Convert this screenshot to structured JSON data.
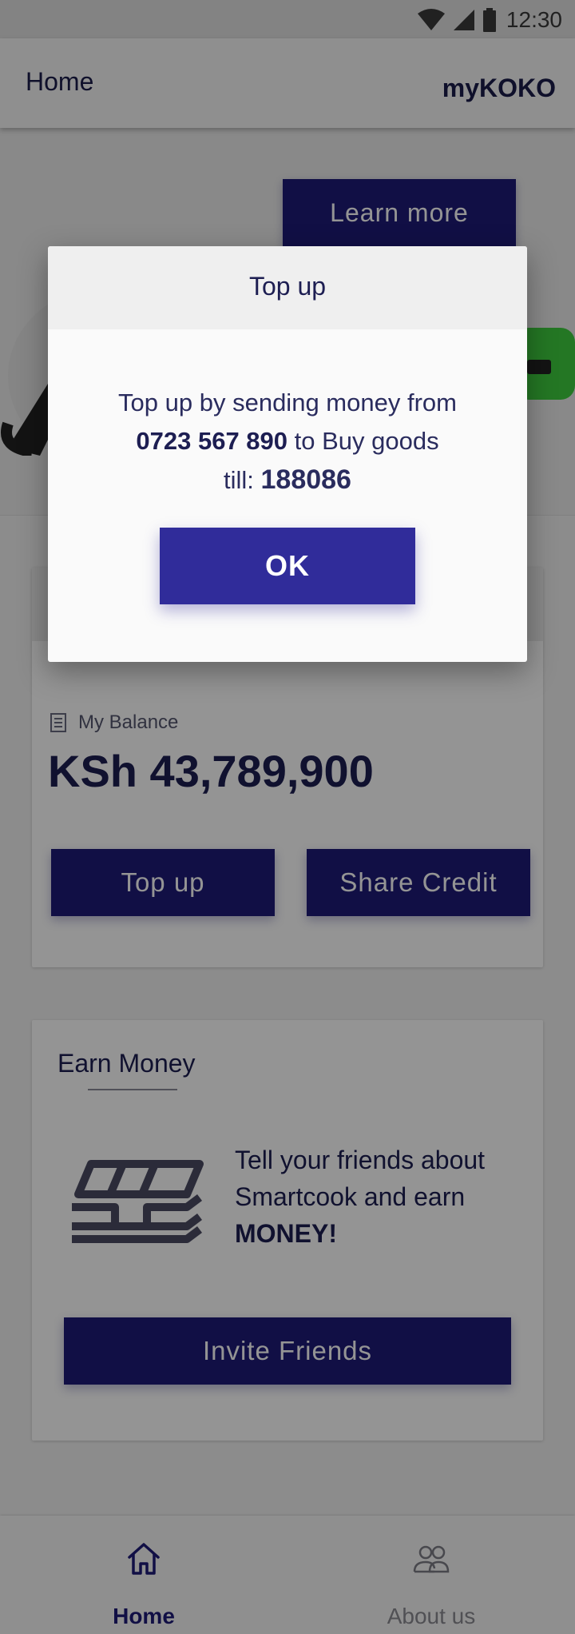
{
  "status_bar": {
    "time": "12:30",
    "icons": [
      "wifi-icon",
      "signal-icon",
      "battery-icon"
    ]
  },
  "app_bar": {
    "title": "Home",
    "brand": "myKOKO"
  },
  "hero": {
    "learn_more_label": "Learn more"
  },
  "balance_card": {
    "label": "My Balance",
    "amount": "KSh 43,789,900",
    "top_up_label": "Top up",
    "share_credit_label": "Share Credit"
  },
  "earn_card": {
    "title": "Earn Money",
    "text_prefix": "Tell your friends about Smartcook and earn ",
    "text_emphasis": "MONEY!",
    "invite_label": "Invite Friends"
  },
  "bottom_nav": {
    "items": [
      {
        "label": "Home",
        "icon": "home-icon",
        "active": true
      },
      {
        "label": "About us",
        "icon": "people-icon",
        "active": false
      }
    ]
  },
  "dialog": {
    "title": "Top up",
    "line1": "Top up by sending money from",
    "phone": "0723 567 890",
    "line2_suffix": " to Buy goods",
    "till_prefix": "till: ",
    "till_number": "188086",
    "ok_label": "OK"
  },
  "colors": {
    "primary": "#1e1a78",
    "dialog_button": "#302c9a",
    "text_dark": "#1d1e52",
    "background": "#f2f2f2"
  }
}
